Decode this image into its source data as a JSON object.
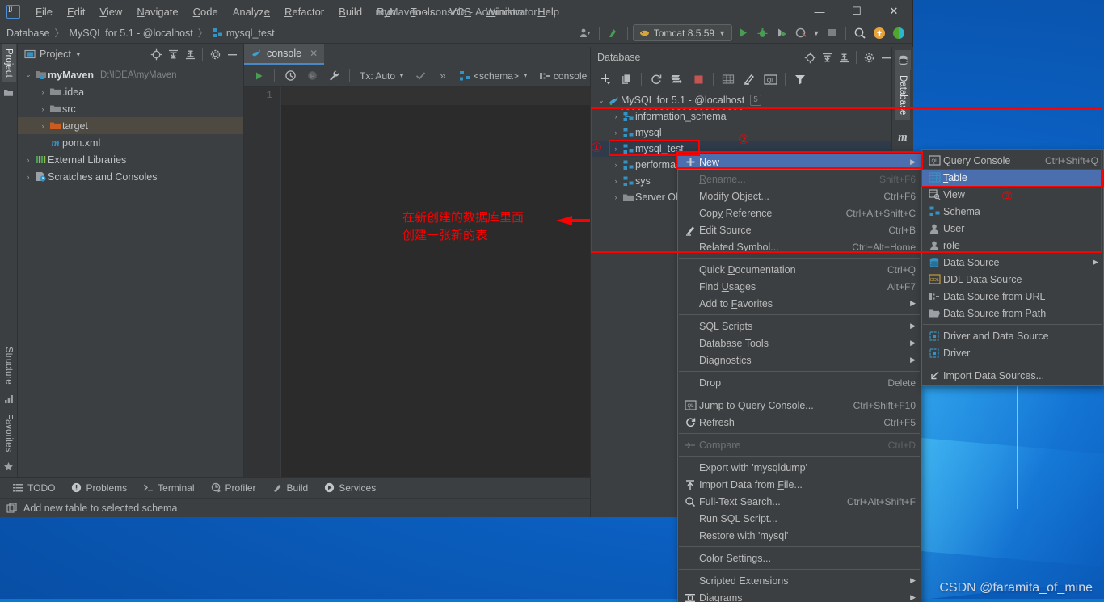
{
  "window": {
    "title": "myMaven - console - Administrator",
    "minimize": "—",
    "maximize": "☐",
    "close": "✕"
  },
  "menubar": [
    {
      "label": "File"
    },
    {
      "label": "Edit"
    },
    {
      "label": "View"
    },
    {
      "label": "Navigate"
    },
    {
      "label": "Code"
    },
    {
      "label": "Analyze"
    },
    {
      "label": "Refactor"
    },
    {
      "label": "Build"
    },
    {
      "label": "Run"
    },
    {
      "label": "Tools"
    },
    {
      "label": "VCS"
    },
    {
      "label": "Window"
    },
    {
      "label": "Help"
    }
  ],
  "navbar": {
    "crumbs": [
      "Database",
      "MySQL for 5.1 - @localhost",
      "mysql_test"
    ],
    "separator": "〉",
    "run_config": "Tomcat 8.5.59"
  },
  "left_rail": {
    "project": "Project",
    "structure": "Structure",
    "favorites": "Favorites"
  },
  "right_rail": {
    "database": "Database",
    "maven": "m"
  },
  "project_panel": {
    "title": "Project",
    "tree": [
      {
        "label": "myMaven",
        "path": "D:\\IDEA\\myMaven",
        "icon": "module-icon",
        "arrow": "⌄",
        "indent": 0,
        "bold": true,
        "selected": false
      },
      {
        "label": ".idea",
        "path": "",
        "icon": "folder-icon",
        "arrow": "›",
        "indent": 1,
        "bold": false,
        "selected": false
      },
      {
        "label": "src",
        "path": "",
        "icon": "folder-icon",
        "arrow": "›",
        "indent": 1,
        "bold": false,
        "selected": false
      },
      {
        "label": "target",
        "path": "",
        "icon": "folder-orange-icon",
        "arrow": "›",
        "indent": 1,
        "bold": false,
        "selected": true
      },
      {
        "label": "pom.xml",
        "path": "",
        "icon": "maven-icon",
        "arrow": "",
        "indent": 1,
        "bold": false,
        "selected": false
      },
      {
        "label": "External Libraries",
        "path": "",
        "icon": "library-icon",
        "arrow": "›",
        "indent": 0,
        "bold": false,
        "selected": false
      },
      {
        "label": "Scratches and Consoles",
        "path": "",
        "icon": "scratch-icon",
        "arrow": "›",
        "indent": 0,
        "bold": false,
        "selected": false
      }
    ]
  },
  "editor": {
    "tab_label": "console",
    "tab_close": "✕",
    "toolbar": {
      "tx_mode": "Tx: Auto",
      "more": "»",
      "schema": "<schema>",
      "session": "console"
    },
    "line_number": "1",
    "annotation_line1": "在新创建的数据库里面",
    "annotation_line2": "创建一张新的表"
  },
  "database_panel": {
    "title": "Database",
    "tree": [
      {
        "label": "MySQL for 5.1 - @localhost",
        "icon": "mysql-icon",
        "arrow": "⌄",
        "indent": 0,
        "badge": "5",
        "selected": false,
        "wavy": true
      },
      {
        "label": "information_schema",
        "icon": "schema-icon",
        "arrow": "›",
        "indent": 1,
        "badge": "",
        "selected": false,
        "wavy": false
      },
      {
        "label": "mysql",
        "icon": "schema-icon",
        "arrow": "›",
        "indent": 1,
        "badge": "",
        "selected": false,
        "wavy": false
      },
      {
        "label": "mysql_test",
        "icon": "schema-icon",
        "arrow": "›",
        "indent": 1,
        "badge": "",
        "selected": true,
        "wavy": false
      },
      {
        "label": "performance_schema",
        "icon": "schema-icon",
        "arrow": "›",
        "indent": 1,
        "badge": "",
        "selected": false,
        "wavy": false
      },
      {
        "label": "sys",
        "icon": "schema-icon",
        "arrow": "›",
        "indent": 1,
        "badge": "",
        "selected": false,
        "wavy": false
      },
      {
        "label": "Server Objects",
        "icon": "folder-icon",
        "arrow": "›",
        "indent": 1,
        "badge": "",
        "selected": false,
        "wavy": false
      }
    ]
  },
  "context_menu": {
    "items": [
      {
        "label": "New",
        "key": "",
        "icon": "plus-icon",
        "submenu": true,
        "disabled": false,
        "highlight": true,
        "mnemonic": ""
      },
      {
        "label": "Rename...",
        "key": "Shift+F6",
        "icon": "",
        "submenu": false,
        "disabled": true,
        "highlight": false,
        "mnemonic": "R"
      },
      {
        "label": "Modify Object...",
        "key": "Ctrl+F6",
        "icon": "",
        "submenu": false,
        "disabled": false,
        "highlight": false,
        "mnemonic": ""
      },
      {
        "label": "Copy Reference",
        "key": "Ctrl+Alt+Shift+C",
        "icon": "",
        "submenu": false,
        "disabled": false,
        "highlight": false,
        "mnemonic": "y"
      },
      {
        "label": "Edit Source",
        "key": "Ctrl+B",
        "icon": "pencil-icon",
        "submenu": false,
        "disabled": false,
        "highlight": false,
        "mnemonic": ""
      },
      {
        "label": "Related Symbol...",
        "key": "Ctrl+Alt+Home",
        "icon": "",
        "submenu": false,
        "disabled": false,
        "highlight": false,
        "mnemonic": "R"
      },
      {
        "separator": true
      },
      {
        "label": "Quick Documentation",
        "key": "Ctrl+Q",
        "icon": "",
        "submenu": false,
        "disabled": false,
        "highlight": false,
        "mnemonic": "D"
      },
      {
        "label": "Find Usages",
        "key": "Alt+F7",
        "icon": "",
        "submenu": false,
        "disabled": false,
        "highlight": false,
        "mnemonic": "U"
      },
      {
        "label": "Add to Favorites",
        "key": "",
        "icon": "",
        "submenu": true,
        "disabled": false,
        "highlight": false,
        "mnemonic": "F"
      },
      {
        "separator": true
      },
      {
        "label": "SQL Scripts",
        "key": "",
        "icon": "",
        "submenu": true,
        "disabled": false,
        "highlight": false,
        "mnemonic": ""
      },
      {
        "label": "Database Tools",
        "key": "",
        "icon": "",
        "submenu": true,
        "disabled": false,
        "highlight": false,
        "mnemonic": ""
      },
      {
        "label": "Diagnostics",
        "key": "",
        "icon": "",
        "submenu": true,
        "disabled": false,
        "highlight": false,
        "mnemonic": ""
      },
      {
        "separator": true
      },
      {
        "label": "Drop",
        "key": "Delete",
        "icon": "",
        "submenu": false,
        "disabled": false,
        "highlight": false,
        "mnemonic": ""
      },
      {
        "separator": true
      },
      {
        "label": "Jump to Query Console...",
        "key": "Ctrl+Shift+F10",
        "icon": "query-console-icon",
        "submenu": false,
        "disabled": false,
        "highlight": false,
        "mnemonic": ""
      },
      {
        "label": "Refresh",
        "key": "Ctrl+F5",
        "icon": "refresh-icon",
        "submenu": false,
        "disabled": false,
        "highlight": false,
        "mnemonic": ""
      },
      {
        "separator": true
      },
      {
        "label": "Compare",
        "key": "Ctrl+D",
        "icon": "compare-icon",
        "submenu": false,
        "disabled": true,
        "highlight": false,
        "mnemonic": ""
      },
      {
        "separator": true
      },
      {
        "label": "Export with 'mysqldump'",
        "key": "",
        "icon": "",
        "submenu": false,
        "disabled": false,
        "highlight": false,
        "mnemonic": ""
      },
      {
        "label": "Import Data from File...",
        "key": "",
        "icon": "import-icon",
        "submenu": false,
        "disabled": false,
        "highlight": false,
        "mnemonic": "F"
      },
      {
        "label": "Full-Text Search...",
        "key": "Ctrl+Alt+Shift+F",
        "icon": "search-icon",
        "submenu": false,
        "disabled": false,
        "highlight": false,
        "mnemonic": ""
      },
      {
        "label": "Run SQL Script...",
        "key": "",
        "icon": "",
        "submenu": false,
        "disabled": false,
        "highlight": false,
        "mnemonic": ""
      },
      {
        "label": "Restore with 'mysql'",
        "key": "",
        "icon": "",
        "submenu": false,
        "disabled": false,
        "highlight": false,
        "mnemonic": ""
      },
      {
        "separator": true
      },
      {
        "label": "Color Settings...",
        "key": "",
        "icon": "",
        "submenu": false,
        "disabled": false,
        "highlight": false,
        "mnemonic": ""
      },
      {
        "separator": true
      },
      {
        "label": "Scripted Extensions",
        "key": "",
        "icon": "",
        "submenu": true,
        "disabled": false,
        "highlight": false,
        "mnemonic": ""
      },
      {
        "label": "Diagrams",
        "key": "",
        "icon": "diagram-icon",
        "submenu": true,
        "disabled": false,
        "highlight": false,
        "mnemonic": ""
      }
    ]
  },
  "new_submenu": {
    "items": [
      {
        "label": "Query Console",
        "key": "Ctrl+Shift+Q",
        "icon": "query-console-icon",
        "submenu": false,
        "highlight": false,
        "mnemonic": ""
      },
      {
        "label": "Table",
        "key": "",
        "icon": "table-icon",
        "submenu": false,
        "highlight": true,
        "mnemonic": "T"
      },
      {
        "label": "View",
        "key": "",
        "icon": "view-icon",
        "submenu": false,
        "highlight": false,
        "mnemonic": ""
      },
      {
        "label": "Schema",
        "key": "",
        "icon": "schema-icon",
        "submenu": false,
        "highlight": false,
        "mnemonic": ""
      },
      {
        "label": "User",
        "key": "",
        "icon": "user-icon",
        "submenu": false,
        "highlight": false,
        "mnemonic": ""
      },
      {
        "label": "role",
        "key": "",
        "icon": "user-icon",
        "submenu": false,
        "highlight": false,
        "mnemonic": ""
      },
      {
        "label": "Data Source",
        "key": "",
        "icon": "datasource-icon",
        "submenu": true,
        "highlight": false,
        "mnemonic": ""
      },
      {
        "label": "DDL Data Source",
        "key": "",
        "icon": "ddl-icon",
        "submenu": false,
        "highlight": false,
        "mnemonic": ""
      },
      {
        "label": "Data Source from URL",
        "key": "",
        "icon": "url-icon",
        "submenu": false,
        "highlight": false,
        "mnemonic": ""
      },
      {
        "label": "Data Source from Path",
        "key": "",
        "icon": "folder-open-icon",
        "submenu": false,
        "highlight": false,
        "mnemonic": ""
      },
      {
        "separator": true
      },
      {
        "label": "Driver and Data Source",
        "key": "",
        "icon": "driver-icon",
        "submenu": false,
        "highlight": false,
        "mnemonic": ""
      },
      {
        "label": "Driver",
        "key": "",
        "icon": "driver-icon",
        "submenu": false,
        "highlight": false,
        "mnemonic": ""
      },
      {
        "separator": true
      },
      {
        "label": "Import Data Sources...",
        "key": "",
        "icon": "import-ds-icon",
        "submenu": false,
        "highlight": false,
        "mnemonic": ""
      }
    ]
  },
  "bottom_bar": {
    "items": [
      {
        "label": "TODO",
        "icon": "todo-icon"
      },
      {
        "label": "Problems",
        "icon": "problems-icon"
      },
      {
        "label": "Terminal",
        "icon": "terminal-icon"
      },
      {
        "label": "Profiler",
        "icon": "profiler-icon"
      },
      {
        "label": "Build",
        "icon": "build-icon"
      },
      {
        "label": "Services",
        "icon": "services-icon"
      }
    ]
  },
  "status_bar": {
    "message": "Add new table to selected schema"
  },
  "annotations": {
    "badge1": "①",
    "badge2": "②",
    "badge3": "③",
    "color": "#fe0000"
  },
  "watermark": "CSDN @faramita_of_mine",
  "colors": {
    "accent_blue": "#4b6eaf",
    "panel_bg": "#3c3f41",
    "editor_bg": "#2b2b2b",
    "desktop_blue": "#0b5fc0",
    "red": "#fe0000"
  }
}
